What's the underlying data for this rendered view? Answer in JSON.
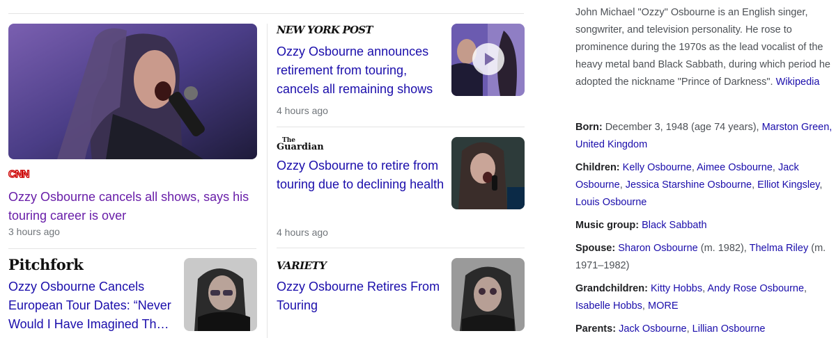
{
  "articles": {
    "cnn": {
      "source": "CNN",
      "headline": "Ozzy Osbourne cancels all shows, says his touring career is over",
      "time": "3 hours ago"
    },
    "pitchfork": {
      "source": "Pitchfork",
      "headline": "Ozzy Osbourne Cancels European Tour Dates: “Never Would I Have Imagined Th…"
    },
    "nypost": {
      "source": "NEW YORK POST",
      "headline": "Ozzy Osbourne announces retirement from touring, cancels all remaining shows",
      "time": "4 hours ago",
      "icon": "play-icon"
    },
    "guardian": {
      "source_the": "The",
      "source_name": "Guardian",
      "headline": "Ozzy Osbourne to retire from touring due to declining health",
      "time": "4 hours ago"
    },
    "variety": {
      "source": "VARIETY",
      "headline": "Ozzy Osbourne Retires From Touring"
    }
  },
  "knowledge_panel": {
    "description": "John Michael \"Ozzy\" Osbourne is an English singer, songwriter, and television personality. He rose to prominence during the 1970s as the lead vocalist of the heavy metal band Black Sabbath, during which period he adopted the nickname \"Prince of Darkness\".",
    "wiki_link": "Wikipedia",
    "born": {
      "label": "Born:",
      "text": "December 3, 1948 (age 74 years),",
      "link": "Marston Green, United Kingdom"
    },
    "children": {
      "label": "Children:",
      "links": [
        "Kelly Osbourne",
        "Aimee Osbourne",
        "Jack Osbourne",
        "Jessica Starshine Osbourne",
        "Elliot Kingsley",
        "Louis Osbourne"
      ]
    },
    "music_group": {
      "label": "Music group:",
      "link": "Black Sabbath"
    },
    "spouse": {
      "label": "Spouse:",
      "link1": "Sharon Osbourne",
      "note1": "(m. 1982),",
      "link2": "Thelma Riley",
      "note2": "(m. 1971–1982)"
    },
    "grandchildren": {
      "label": "Grandchildren:",
      "links": [
        "Kitty Hobbs",
        "Andy Rose Osbourne",
        "Isabelle Hobbs",
        "MORE"
      ]
    },
    "parents": {
      "label": "Parents:",
      "links": [
        "Jack Osbourne",
        "Lillian Osbourne"
      ]
    }
  },
  "colors": {
    "link": "#1a0dab",
    "visited_link": "#681da8",
    "cnn_red": "#cc0000",
    "meta_gray": "#70757a"
  }
}
